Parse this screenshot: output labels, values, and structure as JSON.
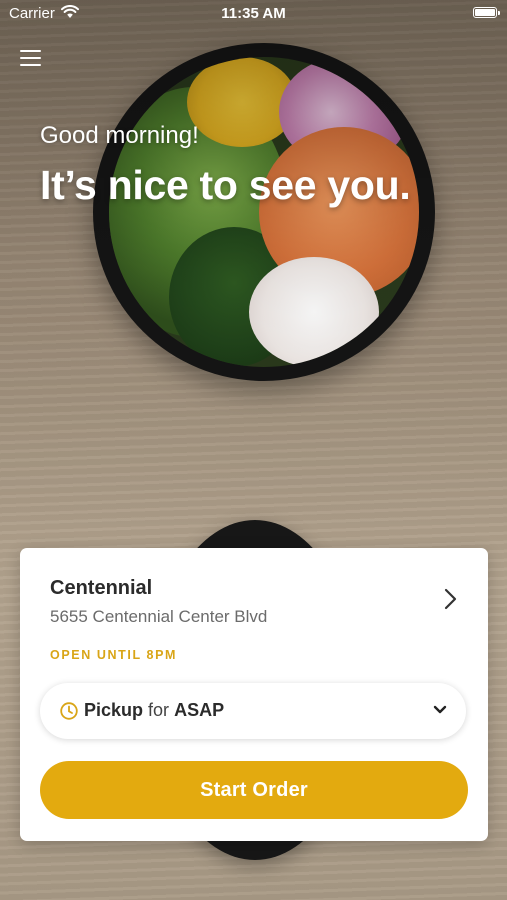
{
  "status_bar": {
    "carrier": "Carrier",
    "time": "11:35 AM"
  },
  "hero": {
    "greeting": "Good morning!",
    "headline": "It’s nice to see you."
  },
  "location": {
    "name": "Centennial",
    "address": "5655 Centennial Center Blvd",
    "hours": "OPEN UNTIL 8PM"
  },
  "order_mode": {
    "type": "Pickup",
    "connector": "for",
    "time": "ASAP"
  },
  "start_button": {
    "label": "Start Order"
  },
  "colors": {
    "accent": "#E3AA0F",
    "hours_text": "#D9A517"
  },
  "icons": [
    "menu-icon",
    "wifi-icon",
    "battery-icon",
    "chevron-right-icon",
    "clock-icon",
    "chevron-down-icon"
  ]
}
